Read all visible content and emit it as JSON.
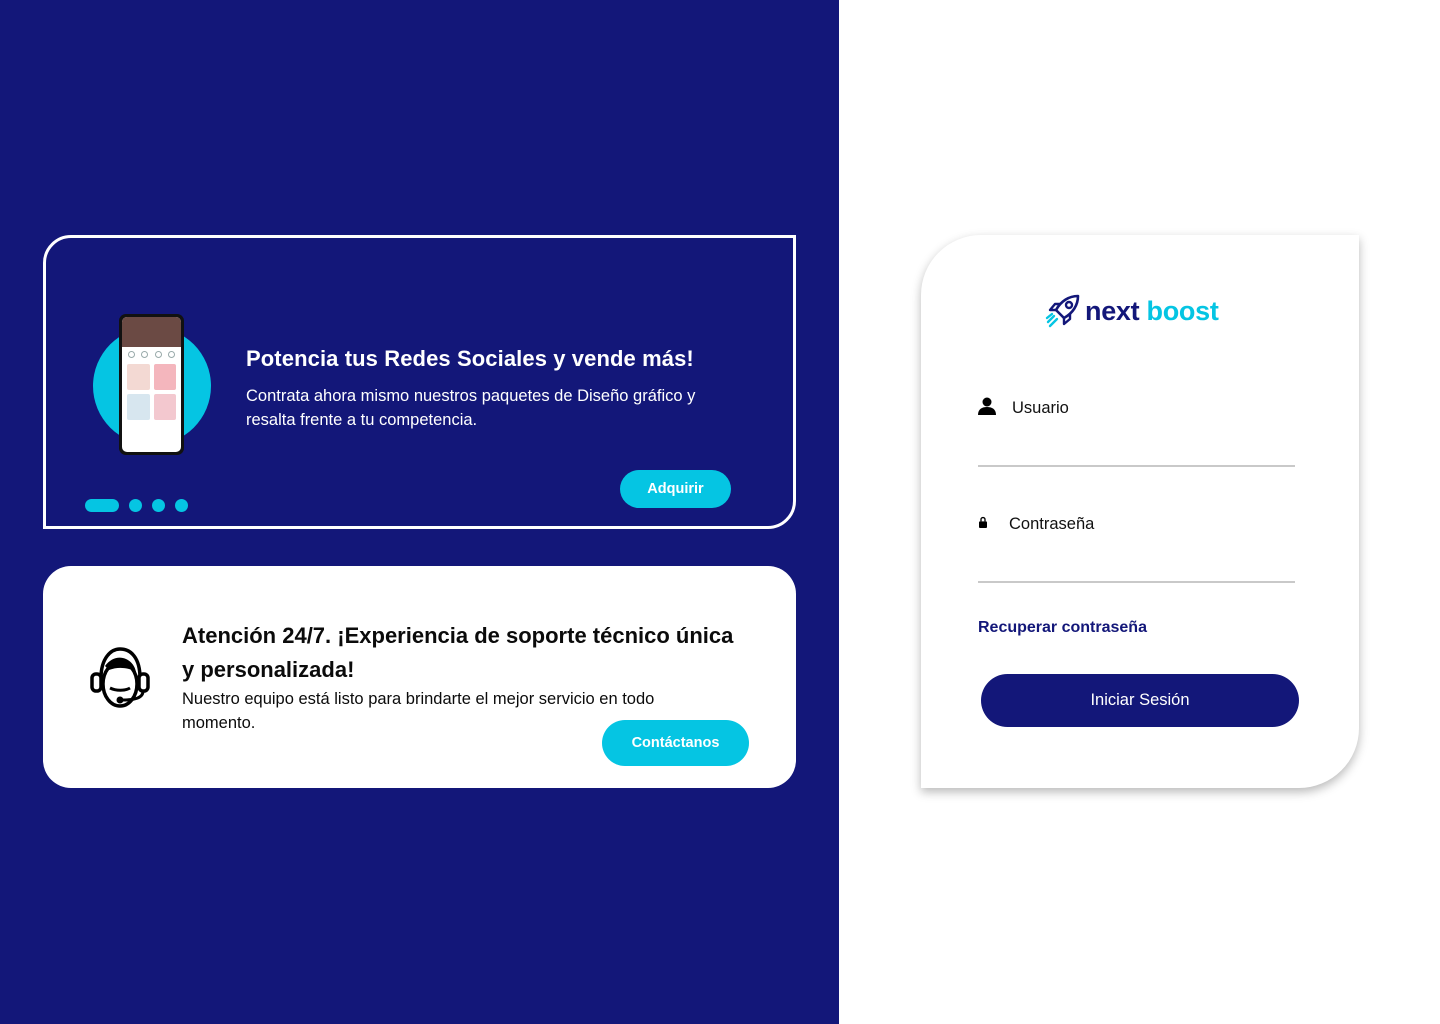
{
  "colors": {
    "navy": "#131779",
    "cyan": "#05c5e3",
    "white": "#ffffff"
  },
  "promo": {
    "title": "Potencia tus Redes Sociales y vende más!",
    "text": "Contrata ahora mismo nuestros paquetes de Diseño gráfico y resalta frente a tu competencia.",
    "button_label": "Adquirir",
    "carousel": {
      "slides": 4,
      "active": 1
    },
    "image_icon": "phone-mockup-icon"
  },
  "support": {
    "title": "Atención 24/7. ¡Experiencia de soporte técnico única y personalizada!",
    "text": "Nuestro equipo está listo para brindarte el mejor servicio en todo momento.",
    "button_label": "Contáctanos",
    "icon": "headset-agent-icon"
  },
  "login": {
    "logo": {
      "word1": "next",
      "word2": "boost",
      "icon": "rocket-icon"
    },
    "username": {
      "label": "Usuario",
      "value": "",
      "icon": "user-icon"
    },
    "password": {
      "label": "Contraseña",
      "value": "",
      "icon": "lock-icon"
    },
    "recover_label": "Recuperar contraseña",
    "submit_label": "Iniciar Sesión"
  }
}
